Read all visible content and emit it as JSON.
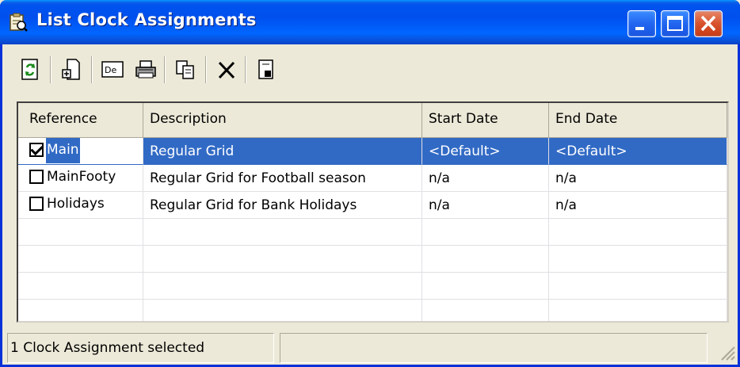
{
  "window": {
    "title": "List Clock Assignments"
  },
  "toolbar": {
    "buttons": [
      {
        "name": "refresh",
        "icon": "refresh-icon"
      },
      {
        "name": "new",
        "icon": "new-document-icon"
      },
      {
        "name": "details",
        "icon": "details-icon",
        "label": "De"
      },
      {
        "name": "print",
        "icon": "print-icon"
      },
      {
        "name": "copy",
        "icon": "copy-icon"
      },
      {
        "name": "delete",
        "icon": "delete-icon"
      },
      {
        "name": "properties",
        "icon": "properties-icon"
      }
    ]
  },
  "grid": {
    "columns": [
      "Reference",
      "Description",
      "Start Date",
      "End Date"
    ],
    "rows": [
      {
        "checked": true,
        "reference": "Main",
        "description": "Regular Grid",
        "start": "<Default>",
        "end": "<Default>",
        "selected": true
      },
      {
        "checked": false,
        "reference": "MainFooty",
        "description": "Regular Grid for Football season",
        "start": "n/a",
        "end": "n/a",
        "selected": false
      },
      {
        "checked": false,
        "reference": "Holidays",
        "description": "Regular Grid for Bank Holidays",
        "start": "n/a",
        "end": "n/a",
        "selected": false
      }
    ]
  },
  "status": {
    "text": "1 Clock Assignment selected",
    "text2": ""
  },
  "colors": {
    "title_blue": "#0053ee",
    "selection": "#316ac5",
    "window_bg": "#ece9d8",
    "close_red": "#d8522c"
  }
}
